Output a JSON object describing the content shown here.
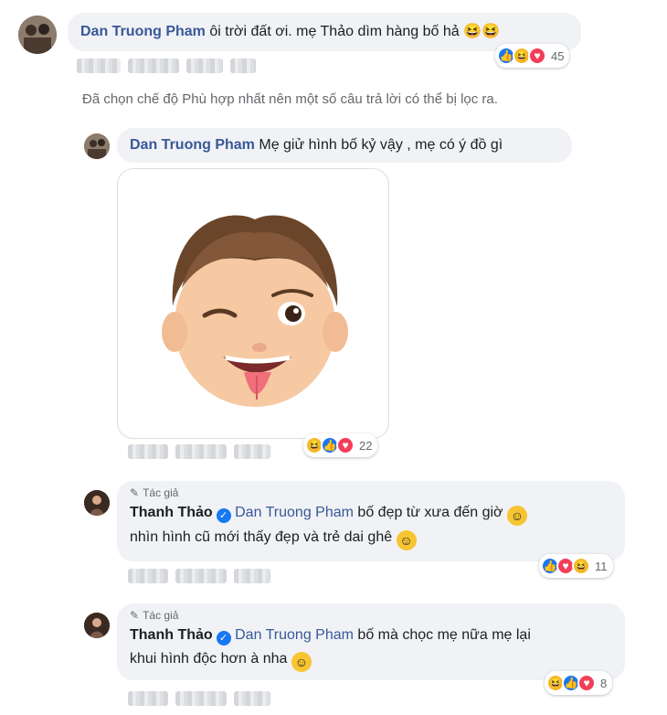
{
  "comment1": {
    "author": "Dan Truong Pham",
    "text": "ôi trời đất ơi. mẹ Thảo dìm hàng bố hả",
    "emojis": "😆😆",
    "reaction_count": "45"
  },
  "filter_notice": "Đã chọn chế độ Phù hợp nhất nên một số câu trả lời có thể bị lọc ra.",
  "reply1": {
    "author": "Dan Truong Pham",
    "text": "Mẹ giử hình bố kỷ vậy , mẹ có ý đồ gì",
    "reaction_count": "22"
  },
  "reply2": {
    "badge": "Tác giả",
    "author": "Thanh Thảo",
    "mention": "Dan Truong Pham",
    "text_line1": "bố đẹp từ xưa đến giờ",
    "text_line2": "nhìn hình cũ mới thấy đẹp và trẻ dai ghê",
    "reaction_count": "11"
  },
  "reply3": {
    "badge": "Tác giả",
    "author": "Thanh Thảo",
    "mention": "Dan Truong Pham",
    "text_line1": "bố mà chọc mẹ nữa mẹ lại",
    "text_line2": "khui hình độc hơn à nha",
    "reaction_count": "8"
  },
  "icons": {
    "like": "like-icon",
    "haha": "haha-icon",
    "love": "love-icon",
    "verified": "verified-badge-icon",
    "pencil": "pencil-icon"
  }
}
